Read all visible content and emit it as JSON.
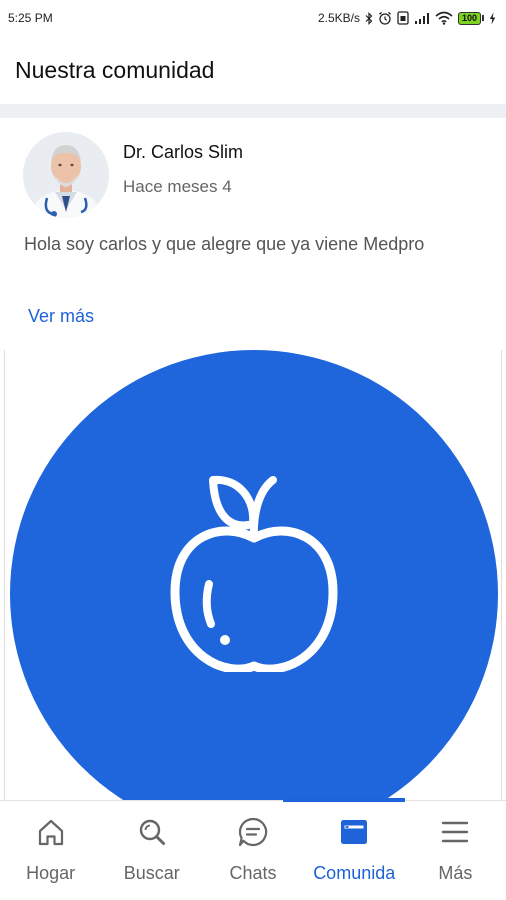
{
  "status_bar": {
    "time": "5:25 PM",
    "speed": "2.5KB/s",
    "battery": "100",
    "icons": [
      "bluetooth-icon",
      "alarm-icon",
      "sim-icon",
      "signal-icon",
      "wifi-icon",
      "battery-icon",
      "charging-icon"
    ]
  },
  "header": {
    "title": "Nuestra comunidad"
  },
  "post": {
    "author": "Dr. Carlos Slim",
    "time": "Hace meses 4",
    "text": "Hola soy carlos y que alegre que ya viene Medpro",
    "see_more": "Ver más",
    "image_icon": "apple-icon",
    "image_color": "#1f65dc"
  },
  "bottom_nav": {
    "items": [
      {
        "label": "Hogar",
        "icon": "home-icon"
      },
      {
        "label": "Buscar",
        "icon": "search-icon"
      },
      {
        "label": "Chats",
        "icon": "chat-icon"
      },
      {
        "label": "Comunida",
        "icon": "community-icon",
        "active": true
      },
      {
        "label": "Más",
        "icon": "menu-icon"
      }
    ],
    "active_color": "#1e63d7",
    "inactive_color": "#666666"
  }
}
